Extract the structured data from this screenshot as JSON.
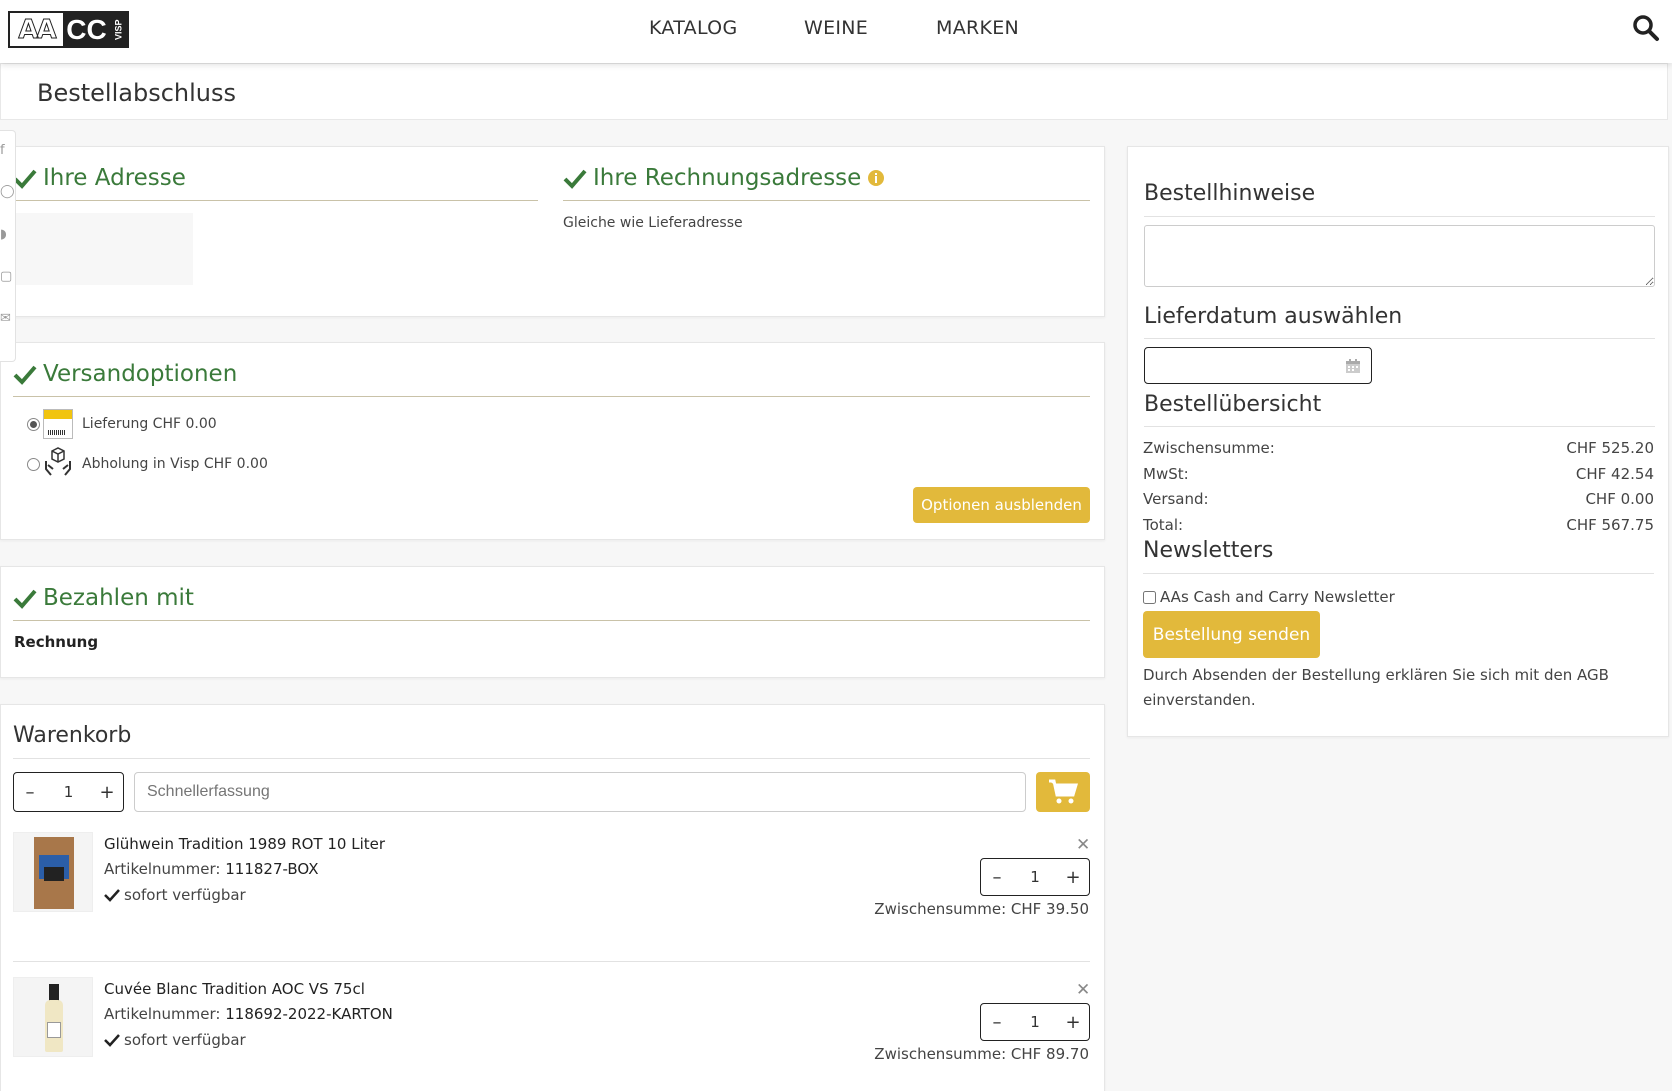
{
  "header": {
    "logo": {
      "aa": "AA",
      "cc": "CC",
      "visp": "VISP"
    },
    "nav": [
      "KATALOG",
      "WEINE",
      "MARKEN"
    ]
  },
  "page_title": "Bestellabschluss",
  "address": {
    "heading": "Ihre Adresse"
  },
  "billing": {
    "heading": "Ihre Rechnungsadresse",
    "text": "Gleiche wie Lieferadresse"
  },
  "shipping": {
    "heading": "Versandoptionen",
    "options": [
      {
        "label": "Lieferung CHF 0.00",
        "selected": true,
        "icon": "post-delivery-icon"
      },
      {
        "label": "Abholung in Visp CHF 0.00",
        "selected": false,
        "icon": "pickup-hands-box-icon"
      }
    ],
    "hide_button": "Optionen ausblenden"
  },
  "payment": {
    "heading": "Bezahlen mit",
    "method": "Rechnung"
  },
  "cart": {
    "heading": "Warenkorb",
    "quick_qty": "1",
    "quick_placeholder": "Schnellerfassung",
    "items": [
      {
        "name": "Glühwein Tradition 1989 ROT 10 Liter",
        "sku_label": "Artikelnummer:",
        "sku": "111827-BOX",
        "availability": "sofort verfügbar",
        "qty": "1",
        "subtotal": "Zwischensumme: CHF 39.50"
      },
      {
        "name": "Cuvée Blanc Tradition AOC VS 75cl",
        "sku_label": "Artikelnummer:",
        "sku": "118692-2022-KARTON",
        "availability": "sofort verfügbar",
        "qty": "1",
        "subtotal": "Zwischensumme: CHF 89.70"
      }
    ]
  },
  "sidebar": {
    "notes_heading": "Bestellhinweise",
    "delivery_heading": "Lieferdatum auswählen",
    "overview_heading": "Bestellübersicht",
    "summary": [
      {
        "label": "Zwischensumme:",
        "value": "CHF 525.20"
      },
      {
        "label": "MwSt:",
        "value": "CHF 42.54"
      },
      {
        "label": "Versand:",
        "value": "CHF 0.00"
      },
      {
        "label": "Total:",
        "value": "CHF 567.75"
      }
    ],
    "newsletter_heading": "Newsletters",
    "newsletter_label": "AAs Cash and Carry Newsletter",
    "submit": "Bestellung senden",
    "terms": "Durch Absenden der Bestellung erklären Sie sich mit den AGB einverstanden."
  },
  "colors": {
    "accent": "#e2b93b",
    "green": "#3a7a3a"
  }
}
